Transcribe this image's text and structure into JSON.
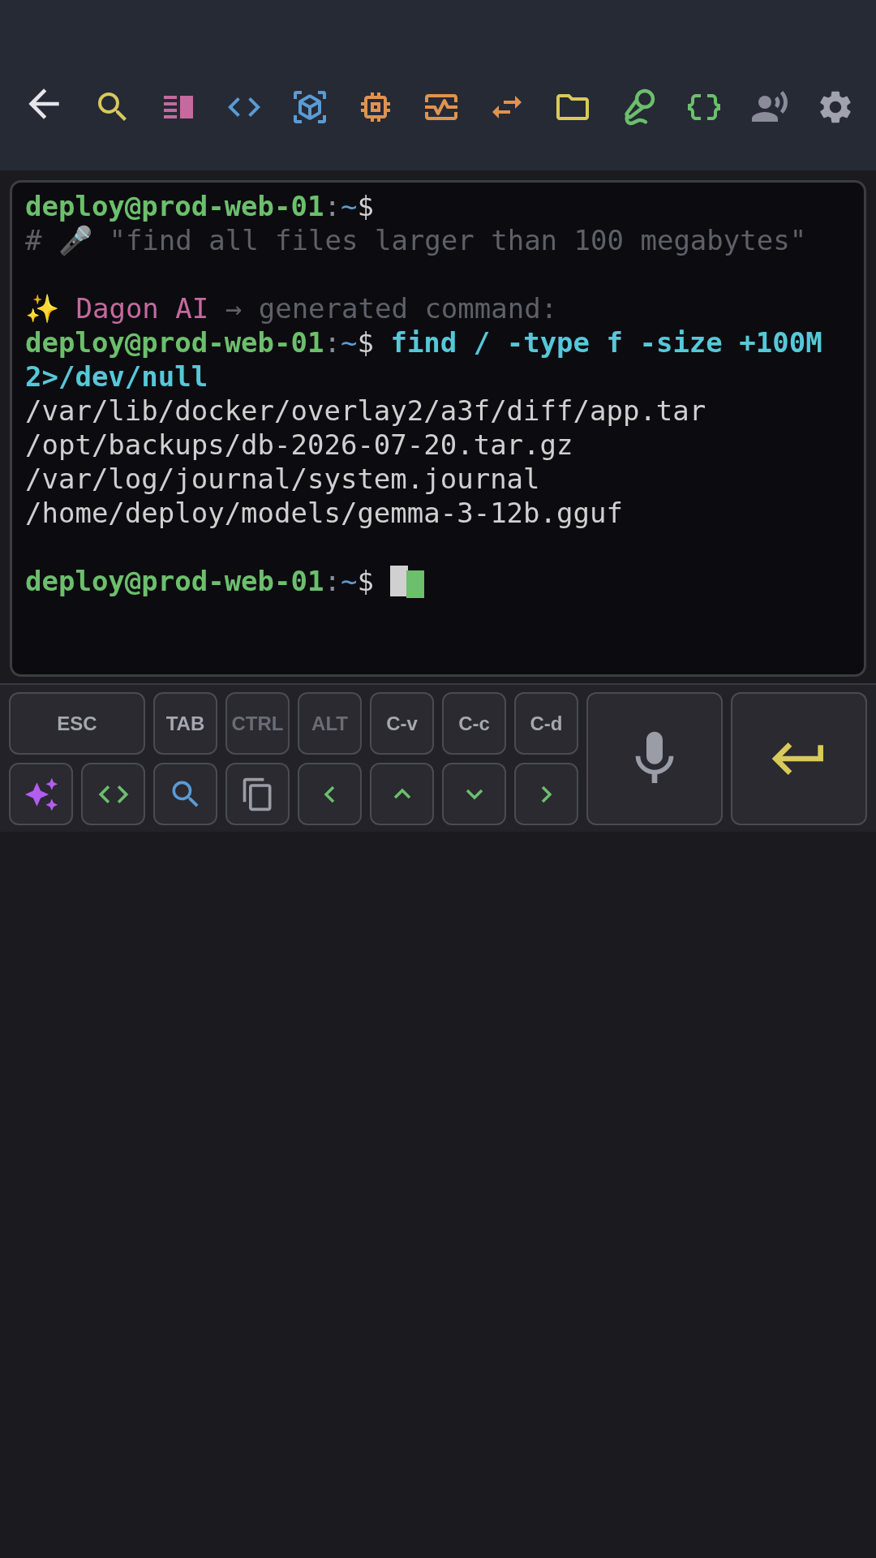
{
  "toolbar": {
    "items": [
      {
        "kind": "back",
        "color": "#e6e6ea"
      },
      {
        "kind": "search",
        "color": "#d9c95a"
      },
      {
        "kind": "split",
        "color": "#c46a9e"
      },
      {
        "kind": "code",
        "color": "#5a9bd5"
      },
      {
        "kind": "cube",
        "color": "#5a9bd5"
      },
      {
        "kind": "chip",
        "color": "#e0934f"
      },
      {
        "kind": "monitor",
        "color": "#e0934f"
      },
      {
        "kind": "swap",
        "color": "#e0934f"
      },
      {
        "kind": "folder",
        "color": "#d9c95a"
      },
      {
        "kind": "mic-cable",
        "color": "#6cbf6c"
      },
      {
        "kind": "braces",
        "color": "#6cbf6c"
      },
      {
        "kind": "voice",
        "color": "#8a8d99"
      },
      {
        "kind": "settings",
        "color": "#a0a3ad"
      }
    ]
  },
  "terminal": {
    "lines": [
      {
        "kind": "prompt",
        "user_host": "deploy@prod-web-01",
        "separator": ":",
        "path": "~",
        "symbol": "$"
      },
      {
        "kind": "comment",
        "text": "# 🎤 \"find all files larger than 100 megabytes\""
      },
      {
        "kind": "blank"
      },
      {
        "kind": "ai",
        "emoji": "✨",
        "name": "Dagon AI",
        "arrow": "→",
        "note": "generated command:"
      },
      {
        "kind": "prompt",
        "user_host": "deploy@prod-web-01",
        "separator": ":",
        "path": "~",
        "symbol": "$",
        "command": "find / -type f -size +100M 2>/dev/null"
      },
      {
        "kind": "output",
        "text": "/var/lib/docker/overlay2/a3f/diff/app.tar"
      },
      {
        "kind": "output",
        "text": "/opt/backups/db-2026-07-20.tar.gz"
      },
      {
        "kind": "output",
        "text": "/var/log/journal/system.journal"
      },
      {
        "kind": "output",
        "text": "/home/deploy/models/gemma-3-12b.gguf"
      },
      {
        "kind": "blank"
      },
      {
        "kind": "prompt",
        "user_host": "deploy@prod-web-01",
        "separator": ":",
        "path": "~",
        "symbol": "$",
        "cursor": true
      }
    ]
  },
  "keys": [
    {
      "kind": "wide",
      "label": "ESC"
    },
    {
      "kind": "text",
      "label": "TAB"
    },
    {
      "kind": "text",
      "label": "CTRL",
      "active": false
    },
    {
      "kind": "text",
      "label": "ALT",
      "active": false
    },
    {
      "kind": "text",
      "label": "C-v"
    },
    {
      "kind": "text",
      "label": "C-c"
    },
    {
      "kind": "text",
      "label": "C-d"
    },
    {
      "kind": "voice",
      "color": "#9a9ca6"
    },
    {
      "kind": "enter",
      "color": "#d9c95a"
    },
    {
      "kind": "sparkle",
      "color": "#b45cf0"
    },
    {
      "kind": "code",
      "color": "#6cbf6c"
    },
    {
      "kind": "search",
      "color": "#5a9bd5"
    },
    {
      "kind": "copy",
      "color": "#9a9ca6"
    },
    {
      "kind": "left",
      "color": "#6cbf6c"
    },
    {
      "kind": "up",
      "color": "#6cbf6c"
    },
    {
      "kind": "down",
      "color": "#6cbf6c"
    },
    {
      "kind": "right",
      "color": "#6cbf6c"
    }
  ]
}
